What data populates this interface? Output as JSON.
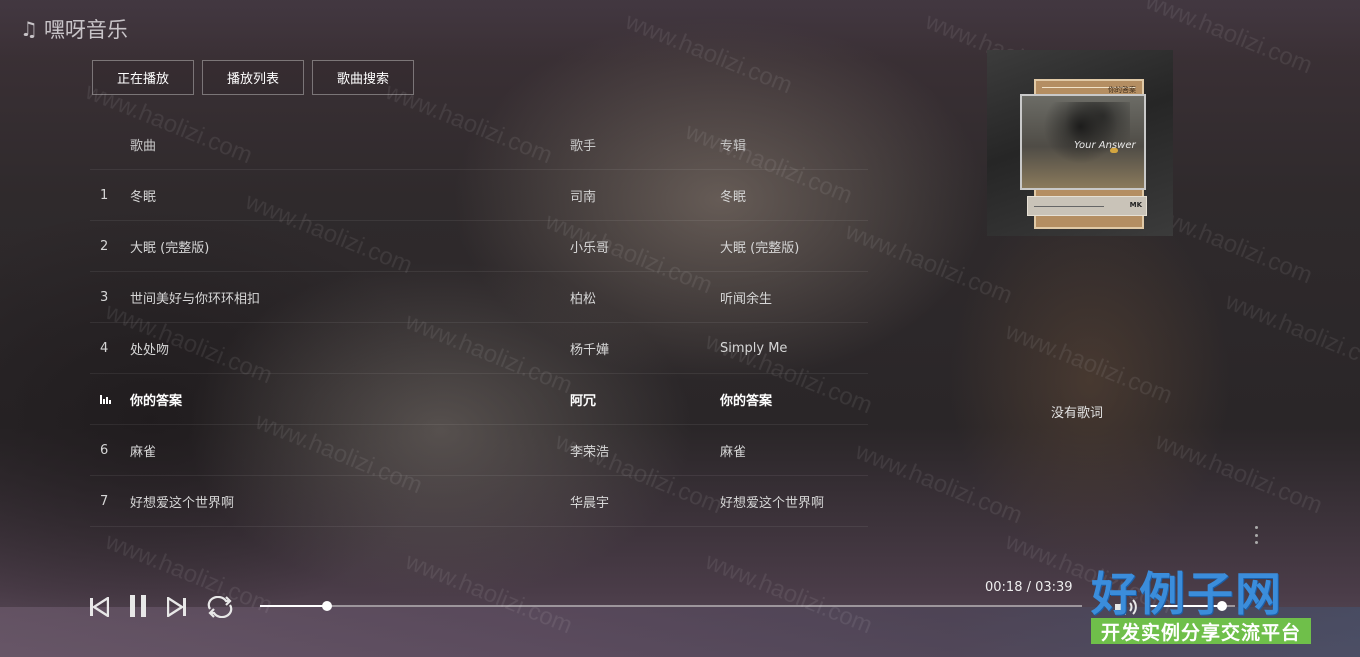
{
  "app": {
    "title": "嘿呀音乐",
    "logo_icon": "music-note-icon"
  },
  "tabs": [
    {
      "label": "正在播放"
    },
    {
      "label": "播放列表"
    },
    {
      "label": "歌曲搜索"
    }
  ],
  "list": {
    "headers": {
      "song": "歌曲",
      "artist": "歌手",
      "album": "专辑"
    },
    "rows": [
      {
        "num": "1",
        "song": "冬眠",
        "artist": "司南",
        "album": "冬眠"
      },
      {
        "num": "2",
        "song": "大眠 (完整版)",
        "artist": "小乐哥",
        "album": "大眠 (完整版)"
      },
      {
        "num": "3",
        "song": "世间美好与你环环相扣",
        "artist": "柏松",
        "album": "听闻余生"
      },
      {
        "num": "4",
        "song": "处处吻",
        "artist": "杨千嬅",
        "album": "Simply Me"
      },
      {
        "num": "",
        "song": "你的答案",
        "artist": "阿冗",
        "album": "你的答案",
        "playing": true
      },
      {
        "num": "6",
        "song": "麻雀",
        "artist": "李荣浩",
        "album": "麻雀"
      },
      {
        "num": "7",
        "song": "好想爱这个世界啊",
        "artist": "华晨宇",
        "album": "好想爱这个世界啊"
      }
    ]
  },
  "now_playing": {
    "lyrics_placeholder": "没有歌词",
    "cover_tag": "你的答案",
    "cover_signature": "Your Answer",
    "cover_mark": "MK"
  },
  "player": {
    "time_display": "00:18 / 03:39",
    "progress": 0.082,
    "volume": 0.85
  },
  "watermark": {
    "text": "www.haolizi.com",
    "brand_title": "好例子网",
    "brand_subtitle": "开发实例分享交流平台"
  },
  "colors": {
    "accent": "#ffffff",
    "brand_blue": "#3b8ddb",
    "brand_green": "#6fbf4a"
  }
}
